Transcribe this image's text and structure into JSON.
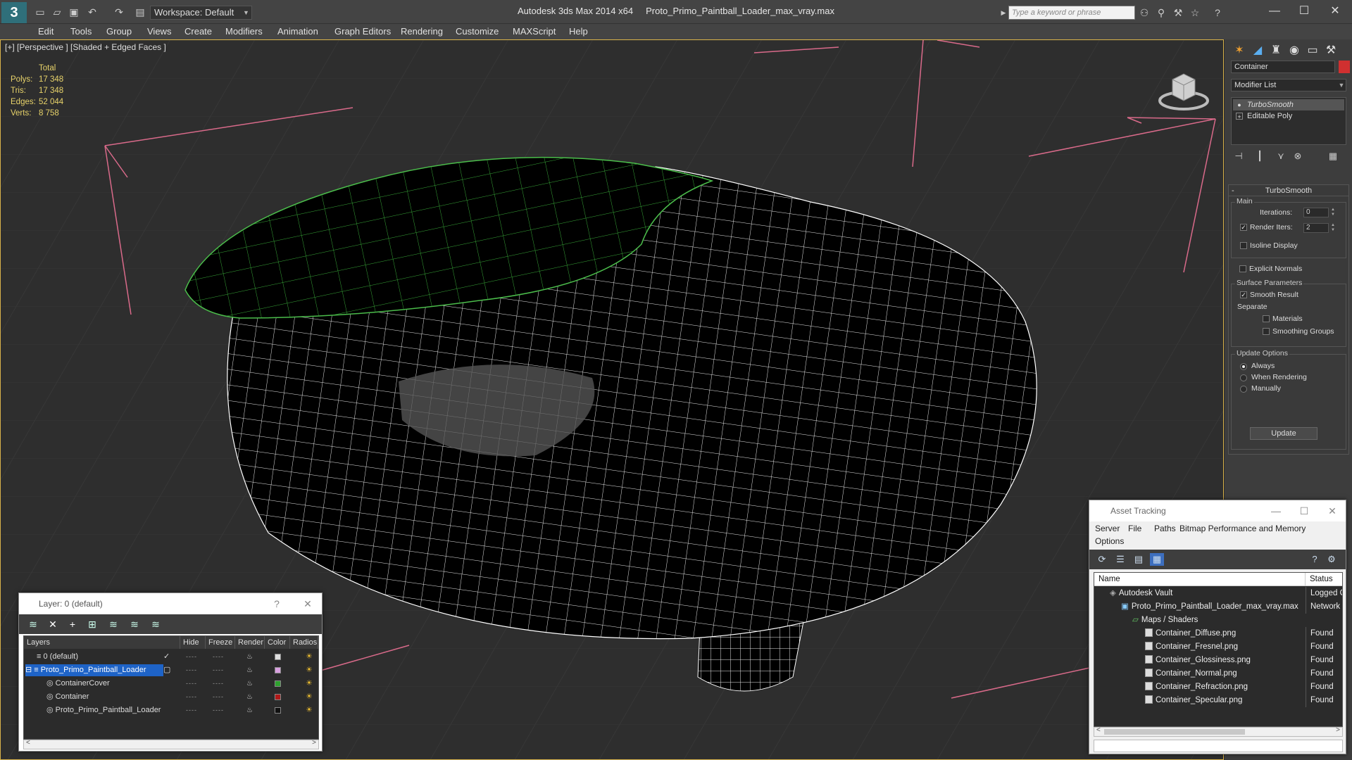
{
  "app": {
    "title_app": "Autodesk 3ds Max  2014 x64",
    "title_file": "Proto_Primo_Paintball_Loader_max_vray.max",
    "workspace": "Workspace: Default",
    "search_placeholder": "Type a keyword or phrase"
  },
  "menu": [
    "Edit",
    "Tools",
    "Group",
    "Views",
    "Create",
    "Modifiers",
    "Animation",
    "Graph Editors",
    "Rendering",
    "Customize",
    "MAXScript",
    "Help"
  ],
  "viewport": {
    "label": "[+] [Perspective ] [Shaded + Edged Faces ]",
    "stats": {
      "header": "Total",
      "rows": [
        {
          "label": "Polys:",
          "value": "17 348"
        },
        {
          "label": "Tris:",
          "value": "17 348"
        },
        {
          "label": "Edges:",
          "value": "52 044"
        },
        {
          "label": "Verts:",
          "value": "8 758"
        }
      ]
    }
  },
  "command_panel": {
    "object_name": "Container",
    "object_color": "#d03030",
    "modifier_list": "Modifier List",
    "stack": [
      "TurboSmooth",
      "Editable Poly"
    ],
    "rollout_title": "TurboSmooth",
    "main_group": "Main",
    "iterations_label": "Iterations:",
    "iterations_value": "0",
    "render_iters_label": "Render Iters:",
    "render_iters_value": "2",
    "isoline": "Isoline Display",
    "explicit_normals": "Explicit Normals",
    "surface_group": "Surface Parameters",
    "smooth_result": "Smooth Result",
    "separate": "Separate",
    "materials": "Materials",
    "smoothing_groups": "Smoothing Groups",
    "update_group": "Update Options",
    "always": "Always",
    "when_rendering": "When Rendering",
    "manually": "Manually",
    "update_button": "Update"
  },
  "layer_window": {
    "title": "Layer: 0 (default)",
    "help": "?",
    "columns": [
      "Layers",
      "Hide",
      "Freeze",
      "Render",
      "Color",
      "Radios"
    ],
    "rows": [
      {
        "name": "0 (default)",
        "color": "#e0e0e0",
        "indent": 1
      },
      {
        "name": "Proto_Primo_Paintball_Loader",
        "color": "#d9a0e0",
        "indent": 0
      },
      {
        "name": "ContainerCover",
        "color": "#2ea02e",
        "indent": 2
      },
      {
        "name": "Container",
        "color": "#b01818",
        "indent": 2
      },
      {
        "name": "Proto_Primo_Paintball_Loader",
        "color": "#111111",
        "indent": 2
      }
    ]
  },
  "asset_window": {
    "title": "Asset Tracking",
    "menu": [
      "Server",
      "File",
      "Paths",
      "Bitmap Performance and Memory",
      "Options"
    ],
    "columns": [
      "Name",
      "Status"
    ],
    "rows": [
      {
        "name": "Autodesk Vault",
        "status": "Logged Out",
        "indent": 1
      },
      {
        "name": "Proto_Primo_Paintball_Loader_max_vray.max",
        "status": "Network",
        "indent": 2
      },
      {
        "name": "Maps / Shaders",
        "status": "",
        "indent": 3
      },
      {
        "name": "Container_Diffuse.png",
        "status": "Found",
        "indent": 4
      },
      {
        "name": "Container_Fresnel.png",
        "status": "Found",
        "indent": 4
      },
      {
        "name": "Container_Glossiness.png",
        "status": "Found",
        "indent": 4
      },
      {
        "name": "Container_Normal.png",
        "status": "Found",
        "indent": 4
      },
      {
        "name": "Container_Refraction.png",
        "status": "Found",
        "indent": 4
      },
      {
        "name": "Container_Specular.png",
        "status": "Found",
        "indent": 4
      }
    ]
  }
}
